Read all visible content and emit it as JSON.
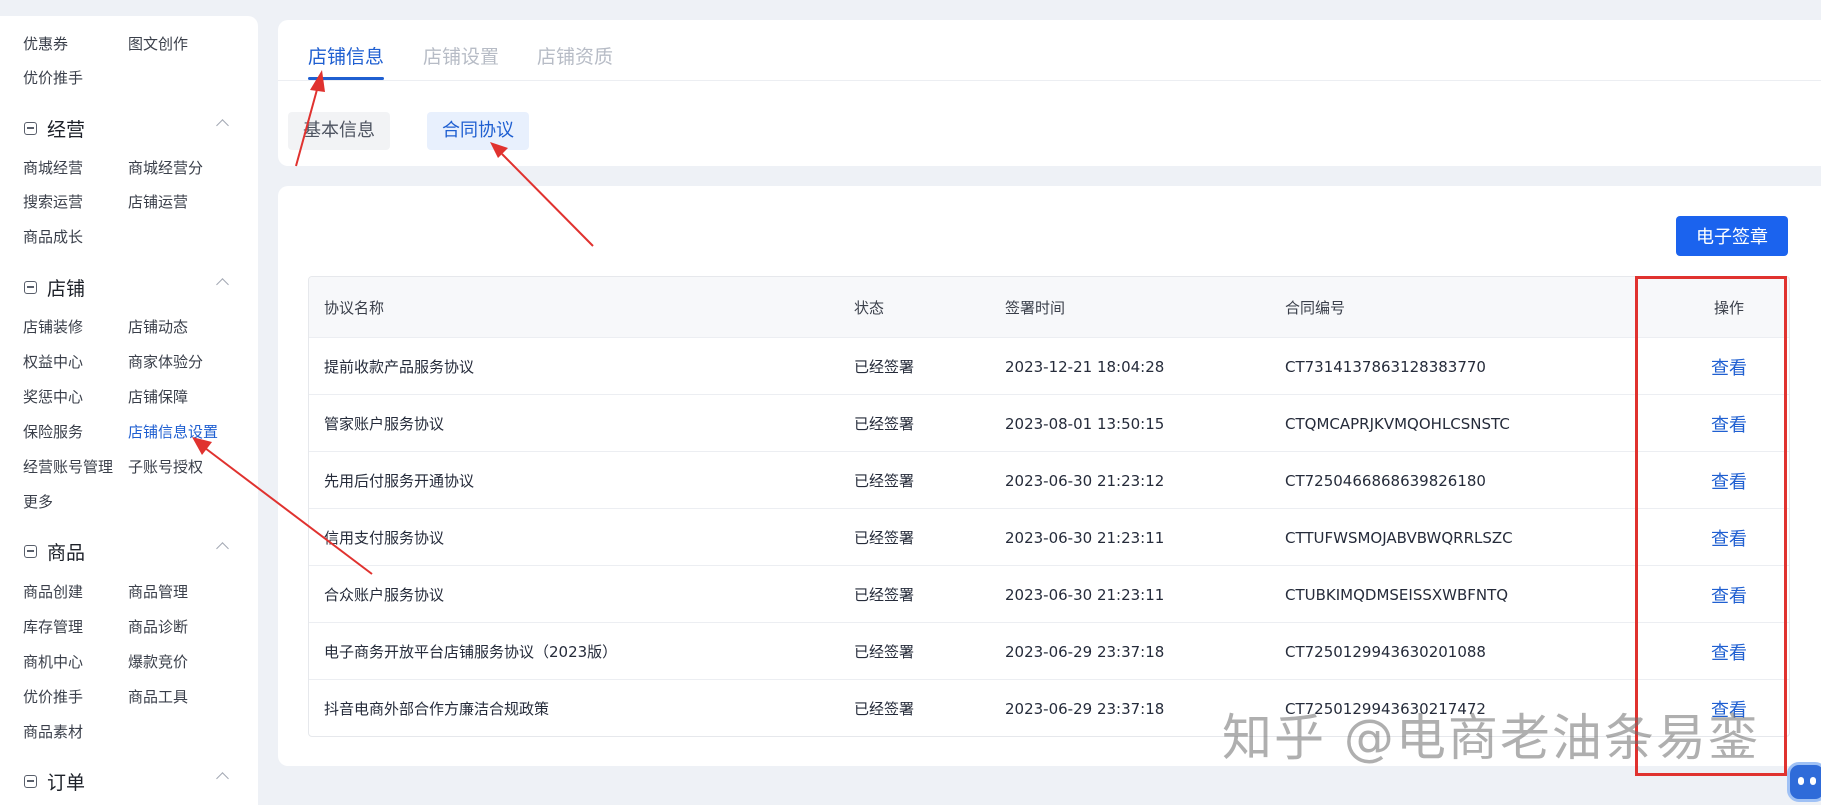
{
  "sidebar": {
    "top_items": [
      "优惠券",
      "图文创作",
      "优价推手"
    ],
    "sections": [
      {
        "title": "经营",
        "items": [
          "商城经营",
          "商城经营分",
          "搜索运营",
          "店铺运营",
          "商品成长"
        ]
      },
      {
        "title": "店铺",
        "items": [
          "店铺装修",
          "店铺动态",
          "权益中心",
          "商家体验分",
          "奖惩中心",
          "店铺保障",
          "保险服务",
          "店铺信息设置",
          "经营账号管理",
          "子账号授权",
          "更多"
        ]
      },
      {
        "title": "商品",
        "items": [
          "商品创建",
          "商品管理",
          "库存管理",
          "商品诊断",
          "商机中心",
          "爆款竞价",
          "优价推手",
          "商品工具",
          "商品素材"
        ]
      },
      {
        "title": "订单",
        "items": []
      }
    ],
    "active_item": "店铺信息设置"
  },
  "tabs": [
    "店铺信息",
    "店铺设置",
    "店铺资质"
  ],
  "subtabs": [
    "基本信息",
    "合同协议"
  ],
  "esign_button": "电子签章",
  "table": {
    "headers": [
      "协议名称",
      "状态",
      "签署时间",
      "合同编号",
      "操作"
    ],
    "rows": [
      {
        "name": "提前收款产品服务协议",
        "status": "已经签署",
        "time": "2023-12-21 18:04:28",
        "no": "CT7314137863128383770",
        "action": "查看"
      },
      {
        "name": "管家账户服务协议",
        "status": "已经签署",
        "time": "2023-08-01 13:50:15",
        "no": "CTQMCAPRJKVMQOHLCSNSTC",
        "action": "查看"
      },
      {
        "name": "先用后付服务开通协议",
        "status": "已经签署",
        "time": "2023-06-30 21:23:12",
        "no": "CT7250466868639826180",
        "action": "查看"
      },
      {
        "name": "信用支付服务协议",
        "status": "已经签署",
        "time": "2023-06-30 21:23:11",
        "no": "CTTUFWSMOJABVBWQRRLSZC",
        "action": "查看"
      },
      {
        "name": "合众账户服务协议",
        "status": "已经签署",
        "time": "2023-06-30 21:23:11",
        "no": "CTUBKIMQDMSEISSXWBFNTQ",
        "action": "查看"
      },
      {
        "name": "电子商务开放平台店铺服务协议（2023版）",
        "status": "已经签署",
        "time": "2023-06-29 23:37:18",
        "no": "CT7250129943630201088",
        "action": "查看"
      },
      {
        "name": "抖音电商外部合作方廉洁合规政策",
        "status": "已经签署",
        "time": "2023-06-29 23:37:18",
        "no": "CT7250129943630217472",
        "action": "查看"
      }
    ]
  },
  "watermark": "知乎 @电商老油条易銮",
  "colors": {
    "accent": "#1f5fd1",
    "button": "#1b63ee",
    "annotation": "#e0322f"
  }
}
